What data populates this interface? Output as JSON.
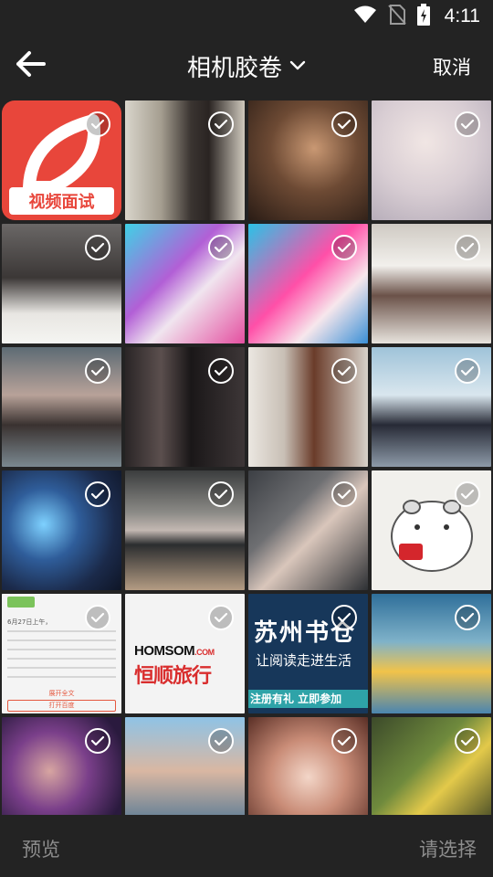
{
  "status_bar": {
    "time": "4:11"
  },
  "toolbar": {
    "title": "相机胶卷",
    "cancel_label": "取消"
  },
  "app_tile": {
    "label": "视频面试"
  },
  "brand_tile": {
    "name_en": "HOMSOM",
    "name_suffix": ".COM",
    "name_cn": "恒顺旅行"
  },
  "book_ad": {
    "title": "苏州书仓",
    "subtitle": "让阅读走进生活",
    "cta": "注册有礼 立即参加"
  },
  "news_tile": {
    "line1": "6月27日上午，",
    "more": "展开全文",
    "open_app": "打开百度"
  },
  "bottom_bar": {
    "preview_label": "预览",
    "select_label": "请选择"
  },
  "colors": {
    "background": "#232323",
    "text_primary": "#ffffff",
    "text_disabled": "#8d8d8d",
    "check_ring": "#ffffff"
  },
  "icons": [
    "back-arrow-icon",
    "wifi-icon",
    "no-sim-icon",
    "battery-charging-icon",
    "chevron-down-icon",
    "check-circle-icon"
  ]
}
